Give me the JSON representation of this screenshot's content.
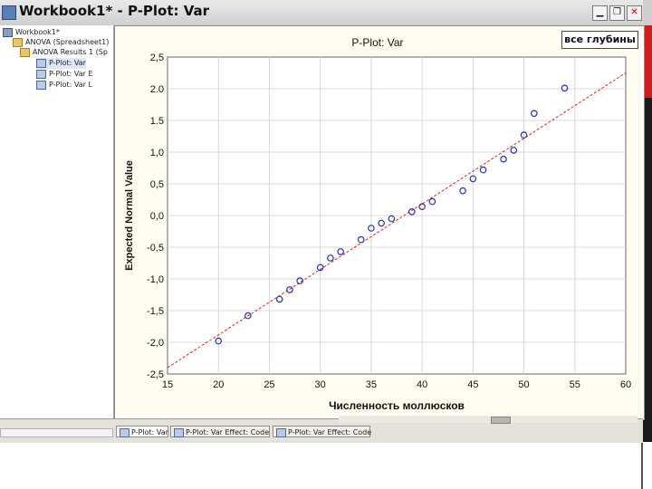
{
  "window": {
    "title": "Workbook1* - P-Plot: Var",
    "minimize_glyph": "▁",
    "restore_glyph": "❐",
    "close_glyph": "✕"
  },
  "tree": {
    "items": [
      {
        "label": "Workbook1*",
        "icon": "workbook-icon"
      },
      {
        "label": "ANOVA (Spreadsheet1)",
        "icon": "folder-icon"
      },
      {
        "label": "ANOVA Results 1 (Sp",
        "icon": "folder-icon"
      },
      {
        "label": "P-Plot: Var",
        "icon": "plot-icon"
      },
      {
        "label": "P-Plot: Var      E",
        "icon": "plot-icon"
      },
      {
        "label": "P-Plot: Var      L",
        "icon": "plot-icon"
      }
    ]
  },
  "legend_label": "все глубины",
  "tabs": [
    {
      "label": "P-Plot: Var"
    },
    {
      "label": "P-Plot: Var     Effect: Code"
    },
    {
      "label": "P-Plot: Var     Effect: Code"
    }
  ],
  "chart_data": {
    "type": "scatter",
    "title": "P-Plot: Var",
    "xlabel": "Численность моллюсков",
    "ylabel": "Expected Normal Value",
    "xlim": [
      15,
      60
    ],
    "ylim": [
      -2.5,
      2.5
    ],
    "xticks": [
      "15",
      "20",
      "25",
      "30",
      "35",
      "40",
      "45",
      "50",
      "55",
      "60"
    ],
    "yticks": [
      "2,5",
      "2.0",
      "1.5",
      "1,0",
      "0,5",
      "0,0",
      "-0,5",
      "-1,0",
      "-1,5",
      "-2,0",
      "-2,5"
    ],
    "grid": true,
    "series": [
      {
        "name": "все глубины",
        "marker": "circle",
        "color": "#2233aa",
        "points": [
          [
            20.0,
            -1.98
          ],
          [
            22.9,
            -1.58
          ],
          [
            26.0,
            -1.32
          ],
          [
            27.0,
            -1.17
          ],
          [
            28.0,
            -1.03
          ],
          [
            30.0,
            -0.82
          ],
          [
            31.0,
            -0.67
          ],
          [
            32.0,
            -0.57
          ],
          [
            34.0,
            -0.38
          ],
          [
            35.0,
            -0.2
          ],
          [
            36.0,
            -0.12
          ],
          [
            37.0,
            -0.05
          ],
          [
            39.0,
            0.06
          ],
          [
            40.0,
            0.14
          ],
          [
            41.0,
            0.22
          ],
          [
            44.0,
            0.39
          ],
          [
            45.0,
            0.58
          ],
          [
            46.0,
            0.72
          ],
          [
            48.0,
            0.89
          ],
          [
            49.0,
            1.03
          ],
          [
            50.0,
            1.27
          ],
          [
            51.0,
            1.61
          ],
          [
            54.0,
            2.01
          ]
        ]
      }
    ],
    "fit_line": {
      "color": "#e02020",
      "style": "dashed",
      "from": [
        15,
        -2.4
      ],
      "to": [
        60,
        2.25
      ]
    }
  }
}
